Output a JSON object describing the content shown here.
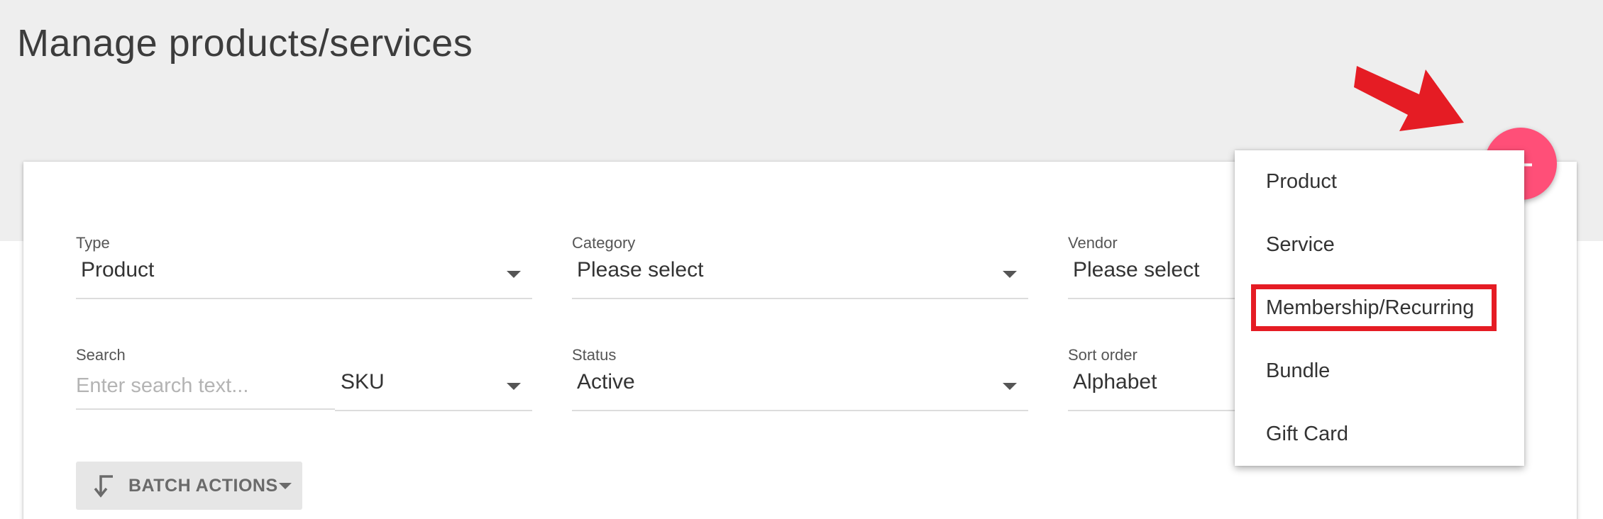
{
  "page": {
    "title": "Manage products/services"
  },
  "filters": {
    "type": {
      "label": "Type",
      "value": "Product"
    },
    "category": {
      "label": "Category",
      "value": "Please select"
    },
    "vendor": {
      "label": "Vendor",
      "value": "Please select"
    },
    "search": {
      "label": "Search",
      "placeholder": "Enter search text...",
      "field_value": "SKU"
    },
    "status": {
      "label": "Status",
      "value": "Active"
    },
    "sort_order": {
      "label": "Sort order",
      "value": "Alphabet"
    }
  },
  "batch_actions": {
    "label": "BATCH ACTIONS",
    "icon": "return-arrow-icon"
  },
  "fab": {
    "icon": "plus-icon",
    "color": "#ff4f78"
  },
  "add_menu": {
    "items": [
      {
        "label": "Product"
      },
      {
        "label": "Service"
      },
      {
        "label": "Membership/Recurring",
        "highlighted": true
      },
      {
        "label": "Bundle"
      },
      {
        "label": "Gift Card"
      }
    ]
  },
  "annotations": {
    "arrow_color": "#e51c24",
    "highlight_color": "#e51c24"
  }
}
